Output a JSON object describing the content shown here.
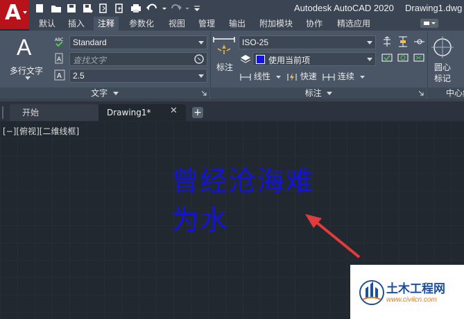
{
  "app": {
    "logo_letter": "A",
    "title": "Autodesk AutoCAD 2020",
    "filename": "Drawing1.dwg"
  },
  "quick_access": [
    "new-icon",
    "open-icon",
    "save-icon",
    "save-as-icon",
    "open-web-icon",
    "save-web-icon",
    "plot-icon",
    "undo-icon",
    "redo-icon",
    "customize-icon"
  ],
  "ribbon_tabs": [
    "默认",
    "插入",
    "注释",
    "参数化",
    "视图",
    "管理",
    "输出",
    "附加模块",
    "协作",
    "精选应用"
  ],
  "active_tab": "注释",
  "text_panel": {
    "multiline_text_label": "多行文字",
    "text_style": "Standard",
    "find_placeholder": "查找文字",
    "text_height": "2.5",
    "panel_title": "文字"
  },
  "dimension_panel": {
    "dimension_label": "标注",
    "dim_style": "ISO-25",
    "layer_value": "使用当前项",
    "linear_label": "线性",
    "quick_label": "快速",
    "continue_label": "连续",
    "panel_title": "标注"
  },
  "centerline_panel": {
    "center_mark_label_1": "圆心",
    "center_mark_label_2": "标记",
    "panel_title": "中心线"
  },
  "file_tabs": {
    "start": "开始",
    "drawing": "Drawing1*"
  },
  "viewport_label": "[−][俯视][二维线框]",
  "mtext": {
    "line1": "曾经沧海难",
    "line2": "为水",
    "color": "#1414d8"
  },
  "watermark": {
    "title": "土木工程网",
    "url": "www.civilcn.com"
  },
  "colors": {
    "app_red": "#b8131b",
    "ribbon": "#4a5566",
    "canvas": "#212830",
    "arrow_red": "#e23b3b"
  }
}
